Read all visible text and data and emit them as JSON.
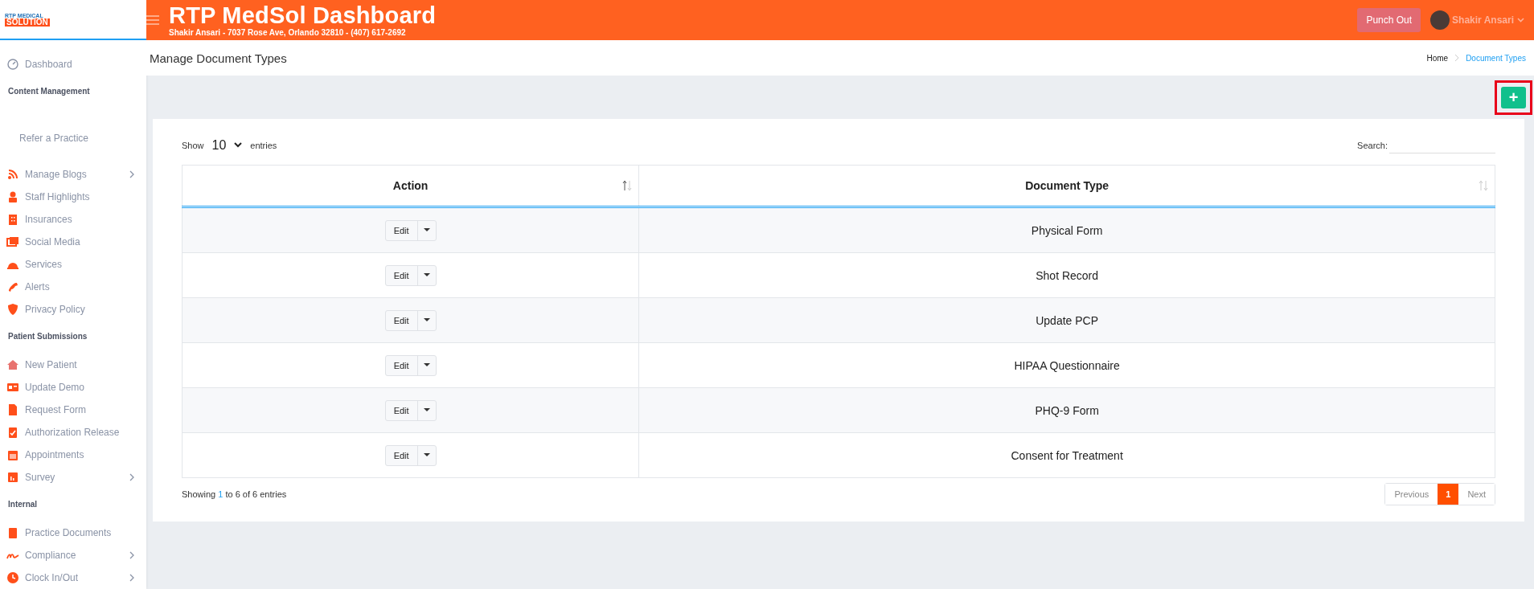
{
  "header": {
    "logo_top": "RTP MEDICAL",
    "logo_bottom": "SOLUTION",
    "title": "RTP MedSol Dashboard",
    "subtitle": "Shakir Ansari - 7037 Rose Ave, Orlando 32810 - (407) 617-2692",
    "punch_button": "Punch Out",
    "user_name": "Shakir Ansari"
  },
  "sidebar": {
    "items": [
      {
        "kind": "item",
        "label": "Dashboard",
        "has_submenu": false
      },
      {
        "kind": "heading",
        "label": "Content Management"
      },
      {
        "kind": "plain",
        "label": "Refer a Practice"
      },
      {
        "kind": "item",
        "label": "Manage Blogs",
        "has_submenu": true
      },
      {
        "kind": "item",
        "label": "Staff Highlights",
        "has_submenu": false
      },
      {
        "kind": "item",
        "label": "Insurances",
        "has_submenu": false
      },
      {
        "kind": "item",
        "label": "Social Media",
        "has_submenu": false
      },
      {
        "kind": "item",
        "label": "Services",
        "has_submenu": false
      },
      {
        "kind": "item",
        "label": "Alerts",
        "has_submenu": false
      },
      {
        "kind": "item",
        "label": "Privacy Policy",
        "has_submenu": false
      },
      {
        "kind": "heading",
        "label": "Patient Submissions"
      },
      {
        "kind": "item",
        "label": "New Patient",
        "has_submenu": false
      },
      {
        "kind": "item",
        "label": "Update Demo",
        "has_submenu": false
      },
      {
        "kind": "item",
        "label": "Request Form",
        "has_submenu": false
      },
      {
        "kind": "item",
        "label": "Authorization Release",
        "has_submenu": false
      },
      {
        "kind": "item",
        "label": "Appointments",
        "has_submenu": false
      },
      {
        "kind": "item",
        "label": "Survey",
        "has_submenu": true
      },
      {
        "kind": "heading",
        "label": "Internal"
      },
      {
        "kind": "item",
        "label": "Practice Documents",
        "has_submenu": false
      },
      {
        "kind": "item",
        "label": "Compliance",
        "has_submenu": true
      },
      {
        "kind": "item",
        "label": "Clock In/Out",
        "has_submenu": true
      }
    ]
  },
  "page": {
    "title": "Manage Document Types",
    "breadcrumb": [
      {
        "label": "Home",
        "selected": false
      },
      {
        "label": "Document Types",
        "selected": true
      }
    ],
    "add_button": "+"
  },
  "table": {
    "show_label": "Show",
    "page_size": "10",
    "entries_label": "entries",
    "search_label": "Search:",
    "columns": [
      "Action",
      "Document Type"
    ],
    "rows": [
      {
        "action": "Edit",
        "document_type": "Physical Form"
      },
      {
        "action": "Edit",
        "document_type": "Shot Record"
      },
      {
        "action": "Edit",
        "document_type": "Update PCP"
      },
      {
        "action": "Edit",
        "document_type": "HIPAA Questionnaire"
      },
      {
        "action": "Edit",
        "document_type": "PHQ-9 Form"
      },
      {
        "action": "Edit",
        "document_type": "Consent for Treatment"
      }
    ],
    "info_parts": [
      "Showing ",
      "1",
      " to 6 of 6 entries"
    ],
    "pagination": [
      {
        "label": "Previous",
        "selected": false
      },
      {
        "label": "1",
        "selected": true
      },
      {
        "label": "Next",
        "selected": false
      }
    ]
  }
}
